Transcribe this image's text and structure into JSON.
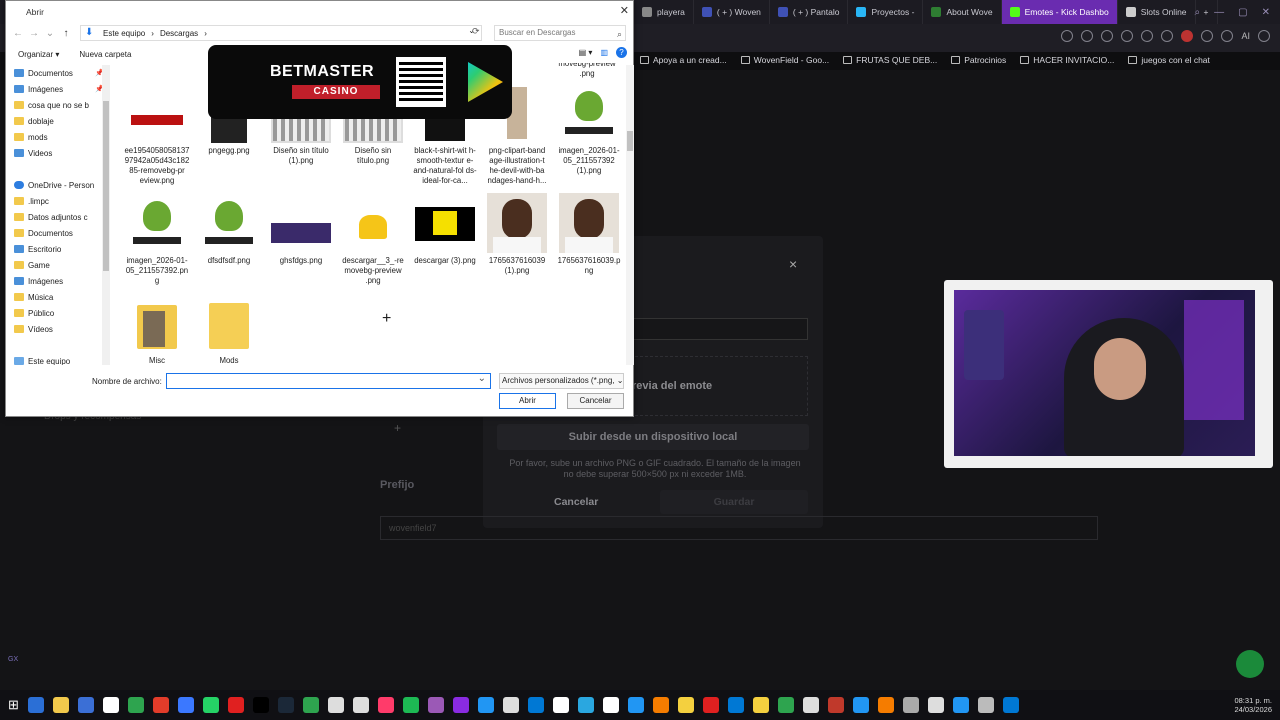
{
  "browser": {
    "tabs": [
      {
        "label": "playera",
        "color": "#888",
        "active": false
      },
      {
        "label": "( + ) Woven",
        "color": "#3f51b5",
        "active": false
      },
      {
        "label": "( + ) Pantalo",
        "color": "#3f51b5",
        "active": false
      },
      {
        "label": "Proyectos -",
        "color": "#29b6f6",
        "active": false
      },
      {
        "label": "About Wove",
        "color": "#2e7d32",
        "active": false
      },
      {
        "label": "Emotes - Kick Dashbo",
        "color": "#53fc18",
        "active": true
      },
      {
        "label": "Slots Online",
        "color": "#ccc",
        "active": false
      }
    ],
    "new_tab": "+",
    "ai_label": "AI",
    "bookmarks": [
      "Apoya a un cread...",
      "WovenField - Goo...",
      "FRUTAS QUE DEB...",
      "Patrocinios",
      "HACER INVITACIO...",
      "juegos con el chat"
    ]
  },
  "page": {
    "modal_preview_label": "revia del emote",
    "upload_button": "Subir desde un dispositivo local",
    "upload_description": "Por favor, sube un archivo PNG o GIF cuadrado. El tamaño de la imagen no debe superar 500×500 px ni exceder 1MB.",
    "cancel_label": "Cancelar",
    "save_label": "Guardar",
    "prefix_label": "Prefijo",
    "prefix_value": "wovenfield7",
    "drop_text": "Drops y recompensas",
    "close_symbol": "×",
    "gx_label": "GX"
  },
  "dialog": {
    "title": "Abrir",
    "close_symbol": "✕",
    "path": [
      "Este equipo",
      "Descargas"
    ],
    "search_placeholder": "Buscar en Descargas",
    "organize_label": "Organizar",
    "new_folder_label": "Nueva carpeta",
    "sidebar": [
      {
        "label": "Documentos",
        "icon": "blue",
        "pinned": true
      },
      {
        "label": "Imágenes",
        "icon": "blue",
        "pinned": true
      },
      {
        "label": "cosa que no se b",
        "icon": "folder",
        "pinned": false
      },
      {
        "label": "doblaje",
        "icon": "folder",
        "pinned": false
      },
      {
        "label": "mods",
        "icon": "folder",
        "pinned": false
      },
      {
        "label": "Videos",
        "icon": "blue",
        "pinned": false
      },
      {
        "label": "",
        "icon": "none",
        "pinned": false
      },
      {
        "label": "OneDrive - Person",
        "icon": "cloud",
        "pinned": false
      },
      {
        "label": ".limpc",
        "icon": "folder",
        "pinned": false
      },
      {
        "label": "Datos adjuntos c",
        "icon": "folder",
        "pinned": false
      },
      {
        "label": "Documentos",
        "icon": "folder",
        "pinned": false
      },
      {
        "label": "Escritorio",
        "icon": "blue",
        "pinned": false
      },
      {
        "label": "Game",
        "icon": "folder",
        "pinned": false
      },
      {
        "label": "Imágenes",
        "icon": "blue",
        "pinned": false
      },
      {
        "label": "Música",
        "icon": "folder",
        "pinned": false
      },
      {
        "label": "Público",
        "icon": "folder",
        "pinned": false
      },
      {
        "label": "Vídeos",
        "icon": "folder",
        "pinned": false
      },
      {
        "label": "",
        "icon": "none",
        "pinned": false
      },
      {
        "label": "Este equipo",
        "icon": "pc",
        "pinned": false
      },
      {
        "label": "Descargas",
        "icon": "blue",
        "pinned": false,
        "selected": true
      }
    ],
    "files": [
      {
        "name": "ee1954058058137 97942a05d43c182 85-removebg-pr eview.png",
        "thumb": "shirt",
        "col": 0,
        "row": 0
      },
      {
        "name": "pngegg.png",
        "thumb": "pants",
        "col": 1,
        "row": 0
      },
      {
        "name": "Diseño sin título (1).png",
        "thumb": "cloth",
        "col": 2,
        "row": 0
      },
      {
        "name": "Diseño sin título.png",
        "thumb": "cloth",
        "col": 3,
        "row": 0
      },
      {
        "name": "black-t-shirt-wit h-smooth-textur e-and-natural-fol ds-ideal-for-ca...",
        "thumb": "dark-shirt",
        "col": 4,
        "row": 0
      },
      {
        "name": "png-clipart-band age-illustration-t he-devil-with-ba ndages-hand-h...",
        "thumb": "devil",
        "col": 5,
        "row": 0
      },
      {
        "name": "imagen_2026-01- 05_211557392 (1).png",
        "thumb": "frog",
        "col": 6,
        "row": 0
      },
      {
        "name": "imagen_2026-01- 05_211557392.pn g",
        "thumb": "frog",
        "col": 0,
        "row": 1
      },
      {
        "name": "dfsdfsdf.png",
        "thumb": "frog",
        "col": 1,
        "row": 1
      },
      {
        "name": "ghsfdgs.png",
        "thumb": "banner",
        "col": 2,
        "row": 1
      },
      {
        "name": "descargar__3_-re movebg-preview .png",
        "thumb": "gold",
        "col": 3,
        "row": 1
      },
      {
        "name": "descargar (3).png",
        "thumb": "gold-dark",
        "col": 4,
        "row": 1
      },
      {
        "name": "1765637616039 (1).png",
        "thumb": "face",
        "col": 5,
        "row": 1
      },
      {
        "name": "1765637616039.p ng",
        "thumb": "face",
        "col": 6,
        "row": 1
      },
      {
        "name": "Misc",
        "thumb": "folder-img",
        "col": 0,
        "row": 2
      },
      {
        "name": "Mods",
        "thumb": "folder-plain",
        "col": 1,
        "row": 2
      }
    ],
    "top_partial_file": "movebg-preview .png",
    "filename_label": "Nombre de archivo:",
    "filename_value": "",
    "filetype_label": "Archivos personalizados (*.png,",
    "open_label": "Abrir",
    "cancel_label": "Cancelar"
  },
  "ad": {
    "brand": "BETMASTER",
    "sub": "CASINO"
  },
  "taskbar": {
    "time": "08:31 p. m.",
    "date": "24/03/2026",
    "icons": [
      "#2b6fd6",
      "#f2c94c",
      "#3b6fd6",
      "#fff",
      "#2ea44f",
      "#e23c2a",
      "#3b78ff",
      "#25d366",
      "#e02020",
      "#000",
      "#1b2838",
      "#2ea44f",
      "#ddd",
      "#ddd",
      "#ff3b6a",
      "#1db954",
      "#9b59b6",
      "#8a2be2",
      "#2196f3",
      "#ddd",
      "#0078d4",
      "#fff",
      "#2aa7e0",
      "#fff",
      "#2196f3",
      "#f57c00",
      "#f4d03f",
      "#e02020",
      "#0078d4",
      "#f4d03f",
      "#2ea44f",
      "#ddd",
      "#c0392b",
      "#2196f3",
      "#f57c00",
      "#aaa",
      "#ddd",
      "#2196f3",
      "#bbb",
      "#0078d4"
    ]
  }
}
